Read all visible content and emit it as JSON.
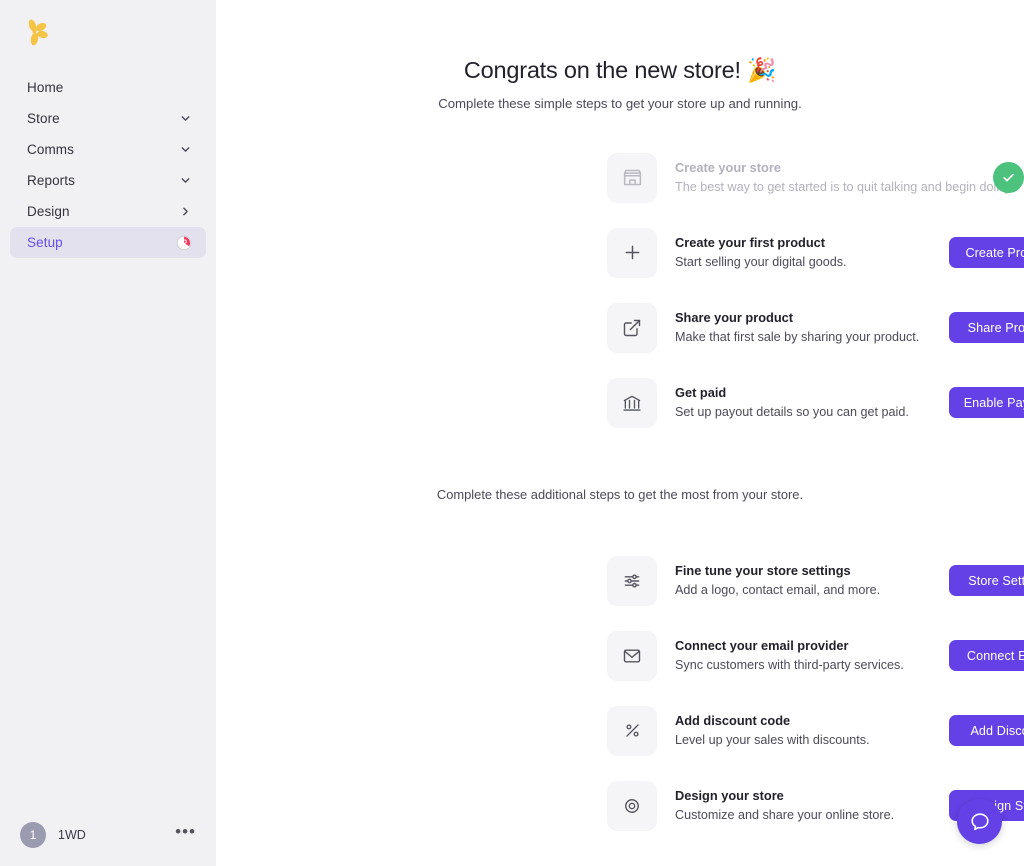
{
  "sidebar": {
    "logo_name": "gumroad-petal-logo",
    "items": [
      {
        "label": "Home",
        "icon": "none",
        "active": false
      },
      {
        "label": "Store",
        "icon": "chevron-down-icon",
        "active": false
      },
      {
        "label": "Comms",
        "icon": "chevron-down-icon",
        "active": false
      },
      {
        "label": "Reports",
        "icon": "chevron-down-icon",
        "active": false
      },
      {
        "label": "Design",
        "icon": "chevron-right-icon",
        "active": false
      },
      {
        "label": "Setup",
        "icon": "progress-badge",
        "active": true
      }
    ],
    "footer": {
      "avatar_initial": "1",
      "account_name": "1WD",
      "menu_label": "•••"
    }
  },
  "main": {
    "hero": {
      "title": "Congrats on the new store! 🎉",
      "subtitle": "Complete these simple steps to get your store up and running."
    },
    "primary_tasks": [
      {
        "icon": "store-icon",
        "title": "Create your store",
        "desc": "The best way to get started is to quit talking and begin doing",
        "state": "done",
        "action": "check-icon"
      },
      {
        "icon": "plus-icon",
        "title": "Create your first product",
        "desc": "Start selling your digital goods.",
        "state": "todo",
        "action": "Create Product"
      },
      {
        "icon": "external-link-icon",
        "title": "Share your product",
        "desc": "Make that first sale by sharing your product.",
        "state": "todo",
        "action": "Share Product"
      },
      {
        "icon": "bank-icon",
        "title": "Get paid",
        "desc": "Set up payout details so you can get paid.",
        "state": "todo",
        "action": "Enable Payouts"
      }
    ],
    "additional_header": "Complete these additional steps to get the most from your store.",
    "additional_tasks": [
      {
        "icon": "sliders-icon",
        "title": "Fine tune your store settings",
        "desc": "Add a logo, contact email, and more.",
        "action": "Store Settings"
      },
      {
        "icon": "envelope-icon",
        "title": "Connect your email provider",
        "desc": "Sync customers with third-party services.",
        "action": "Connect Email"
      },
      {
        "icon": "percent-icon",
        "title": "Add discount code",
        "desc": "Level up your sales with discounts.",
        "action": "Add Discount"
      },
      {
        "icon": "target-icon",
        "title": "Design your store",
        "desc": "Customize and share your online store.",
        "action": "Design Store"
      }
    ],
    "help_button": {
      "icon": "chat-bubble-icon"
    }
  },
  "colors": {
    "accent_purple": "#6441e6",
    "success_green": "#4cc27d",
    "sidebar_bg": "#f1f1f4",
    "active_nav_bg": "#e3e1ee",
    "active_nav_text": "#6b4df0",
    "logo_yellow": "#f6c445",
    "badge_pink": "#ef3d62"
  }
}
